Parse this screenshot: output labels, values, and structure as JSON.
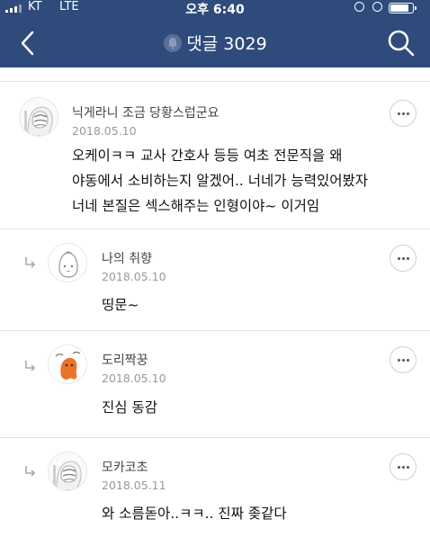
{
  "status_bar": {
    "carrier": "KT",
    "network": "LTE",
    "time": "오후 6:40",
    "battery_level": 0.85
  },
  "header": {
    "title": "댓글 3029",
    "icons": [
      "back-arrow-icon",
      "bell-icon",
      "search-icon"
    ],
    "background": "#2f4b7c"
  },
  "comments": [
    {
      "nickname": "닉게라니 조금 당황스럽군요",
      "date": "2018.05.10",
      "text_lines": [
        "오케이ㅋㅋ 교사 간호사 등등 여초 전문직을 왜",
        "야동에서 소비하는지 알겠어.. 너네가 능력있어봤자",
        "너네 본질은 섹스해주는 인형이야~ 이거임"
      ],
      "is_reply": false
    },
    {
      "nickname": "나의 취향",
      "date": "2018.05.10",
      "text_lines": [
        "띵문~"
      ],
      "is_reply": true
    },
    {
      "nickname": "도리짝꿍",
      "date": "2018.05.10",
      "text_lines": [
        "진심 동감"
      ],
      "is_reply": true
    },
    {
      "nickname": "모카코초",
      "date": "2018.05.11",
      "text_lines": [
        "와 소름돋아..ㅋㅋ.. 진짜 좆같다"
      ],
      "is_reply": true
    }
  ]
}
